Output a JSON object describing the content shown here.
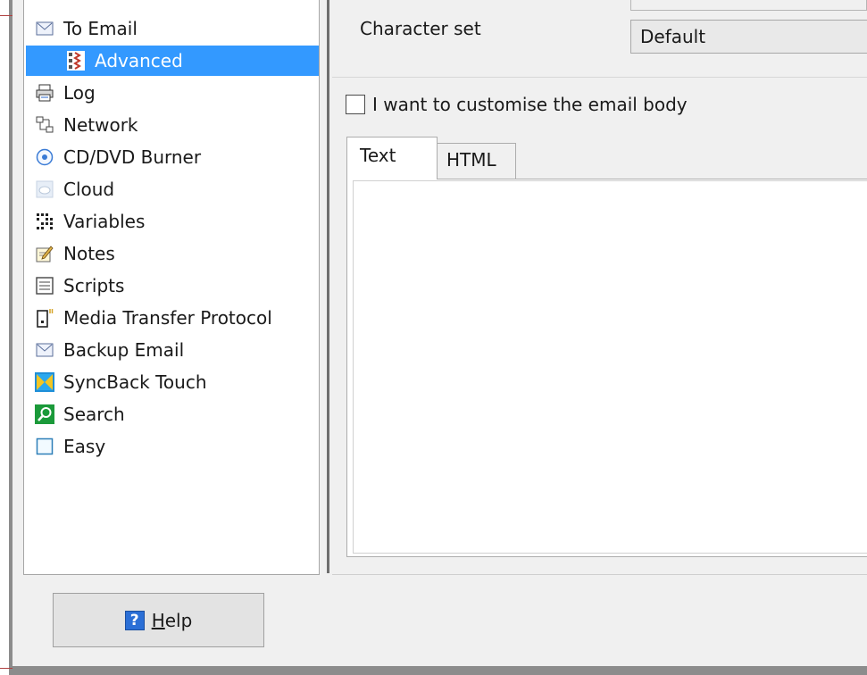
{
  "sidebar": {
    "items": [
      {
        "label": "To Email",
        "icon": "envelope-icon"
      },
      {
        "label": "Advanced",
        "icon": "advanced-settings-icon",
        "selected": true
      },
      {
        "label": "Log",
        "icon": "printer-log-icon"
      },
      {
        "label": "Network",
        "icon": "network-icon"
      },
      {
        "label": "CD/DVD Burner",
        "icon": "disc-icon"
      },
      {
        "label": "Cloud",
        "icon": "cloud-icon"
      },
      {
        "label": "Variables",
        "icon": "variables-grid-icon"
      },
      {
        "label": "Notes",
        "icon": "notes-pencil-icon"
      },
      {
        "label": "Scripts",
        "icon": "scripts-icon"
      },
      {
        "label": "Media Transfer Protocol",
        "icon": "device-icon"
      },
      {
        "label": "Backup Email",
        "icon": "envelope-icon"
      },
      {
        "label": "SyncBack Touch",
        "icon": "syncback-touch-icon"
      },
      {
        "label": "Search",
        "icon": "search-icon"
      },
      {
        "label": "Easy",
        "icon": "easy-square-icon"
      }
    ]
  },
  "email": {
    "charset_label": "Character set",
    "charset_value": "Default",
    "customise_label": "I want to customise the email body",
    "customise_checked": false,
    "tabs": [
      "Text",
      "HTML"
    ],
    "active_tab": "Text",
    "body_text": ""
  },
  "footer": {
    "help_label_underlined": "H",
    "help_label_rest": "elp",
    "help_icon": "question-icon"
  },
  "colors": {
    "selection": "#3399ff",
    "window_bg": "#f0f0f0",
    "help_icon_bg": "#2b6fd6"
  }
}
